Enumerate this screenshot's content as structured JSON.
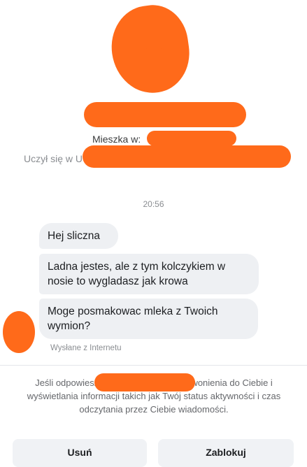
{
  "profile": {
    "lives_in_label": "Mieszka w:",
    "studied_at_label": "Uczył się w U"
  },
  "thread": {
    "timestamp": "20:56",
    "messages": [
      {
        "text": "Hej sliczna"
      },
      {
        "text": "Ladna jestes, ale z tym kolczykiem w nosie to wygladasz jak krowa"
      },
      {
        "text": "Moge posmakowac mleka z Twoich wymion?"
      }
    ],
    "sent_via": "Wysłane z Internetu"
  },
  "request_notice": {
    "text": "Jeśli odpowiesz                           zie mieć możliwość dzwonienia do Ciebie i wyświetlania informacji takich jak Twój status aktywności i czas odczytania przez Ciebie wiadomości."
  },
  "actions": {
    "delete_label": "Usuń",
    "block_label": "Zablokuj"
  },
  "colors": {
    "redaction": "#ff6a1a",
    "bubble_bg": "#eef0f3",
    "muted_text": "#8a8d91",
    "button_bg": "#f0f2f5"
  }
}
